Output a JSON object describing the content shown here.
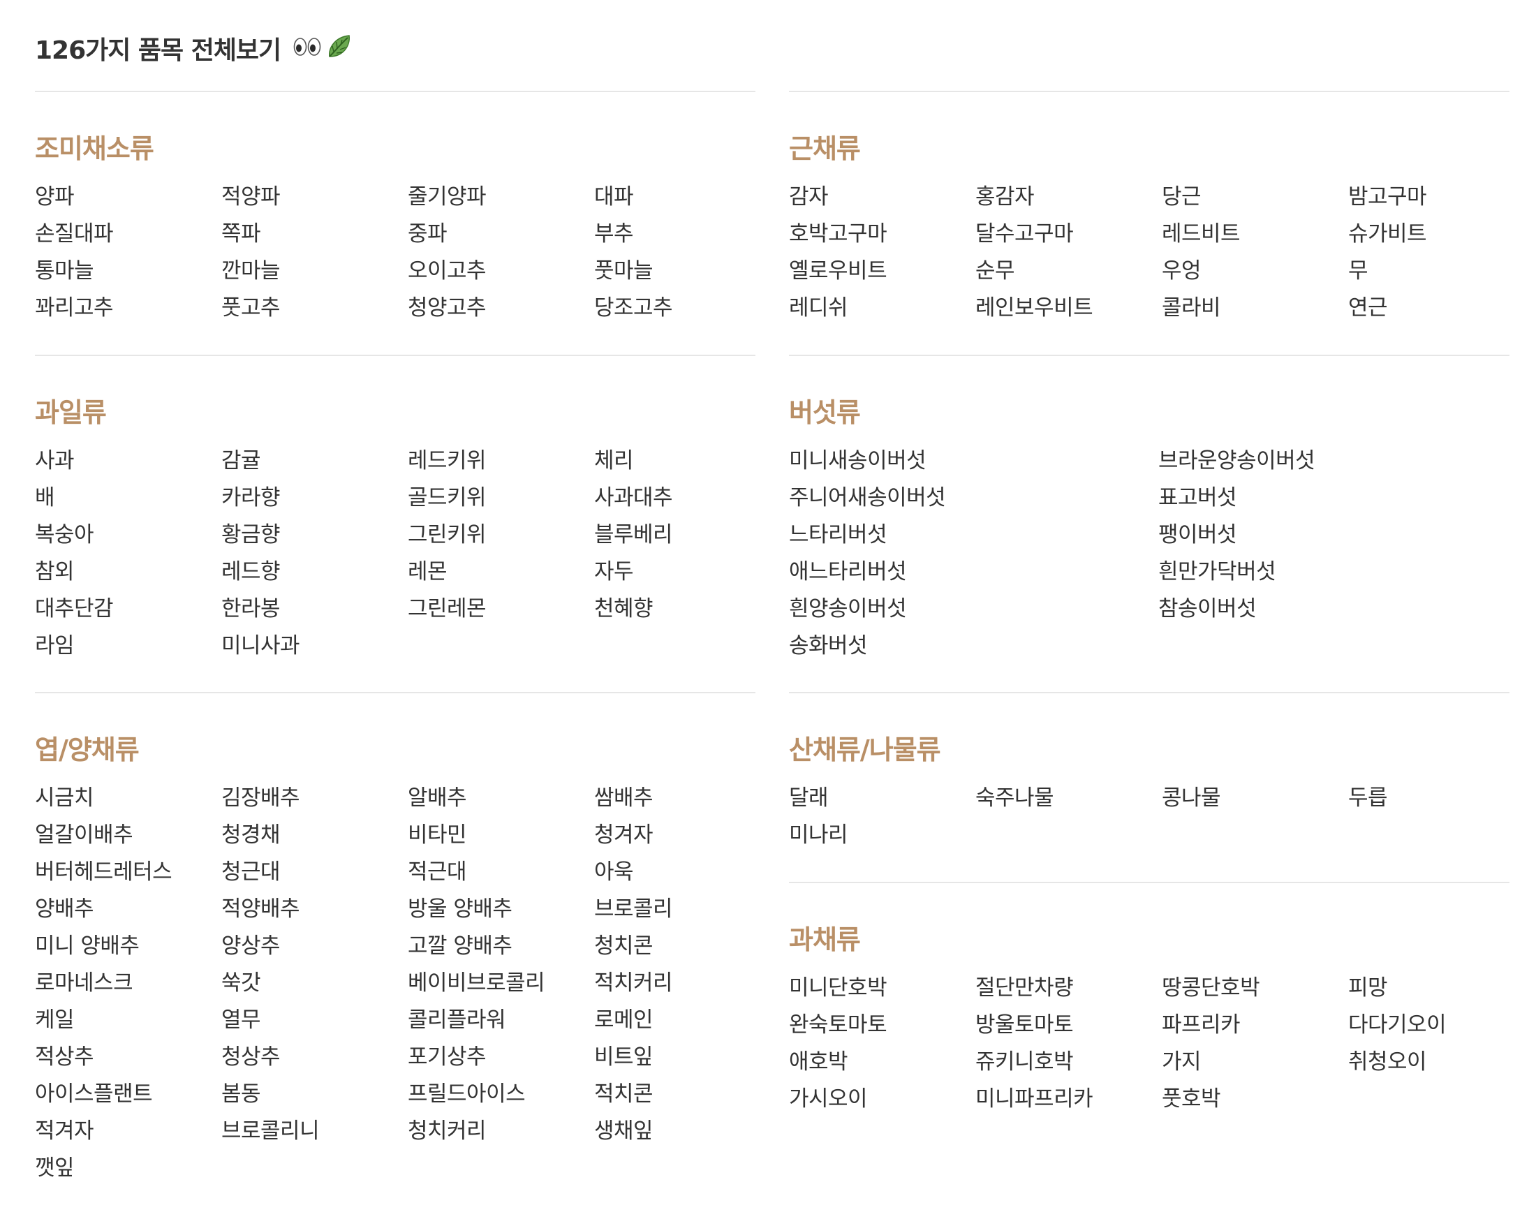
{
  "page": {
    "title": "126가지 품목 전체보기",
    "title_icons": [
      "eyes-icon",
      "leafy-green-icon"
    ]
  },
  "colors": {
    "section_title": "#b98f66",
    "divider": "#e6e6e6",
    "text": "#333333"
  },
  "sections": {
    "seasoning": {
      "title": "조미채소류",
      "items": [
        "양파",
        "적양파",
        "줄기양파",
        "대파",
        "손질대파",
        "쪽파",
        "중파",
        "부추",
        "통마늘",
        "깐마늘",
        "오이고추",
        "풋마늘",
        "꽈리고추",
        "풋고추",
        "청양고추",
        "당조고추"
      ]
    },
    "root": {
      "title": "근채류",
      "items": [
        "감자",
        "홍감자",
        "당근",
        "밤고구마",
        "호박고구마",
        "달수고구마",
        "레드비트",
        "슈가비트",
        "옐로우비트",
        "순무",
        "우엉",
        "무",
        "레디쉬",
        "레인보우비트",
        "콜라비",
        "연근"
      ]
    },
    "fruit": {
      "title": "과일류",
      "items": [
        "사과",
        "감귤",
        "레드키위",
        "체리",
        "배",
        "카라향",
        "골드키위",
        "사과대추",
        "복숭아",
        "황금향",
        "그린키위",
        "블루베리",
        "참외",
        "레드향",
        "레몬",
        "자두",
        "대추단감",
        "한라봉",
        "그린레몬",
        "천혜향",
        "라임",
        "미니사과"
      ]
    },
    "mushroom": {
      "title": "버섯류",
      "items": [
        "미니새송이버섯",
        "브라운양송이버섯",
        "주니어새송이버섯",
        "표고버섯",
        "느타리버섯",
        "팽이버섯",
        "애느타리버섯",
        "흰만가닥버섯",
        "흰양송이버섯",
        "참송이버섯",
        "송화버섯"
      ]
    },
    "leafy": {
      "title": "엽/양채류",
      "items": [
        "시금치",
        "김장배추",
        "알배추",
        "쌈배추",
        "얼갈이배추",
        "청경채",
        "비타민",
        "청겨자",
        "버터헤드레터스",
        "청근대",
        "적근대",
        "아욱",
        "양배추",
        "적양배추",
        "방울 양배추",
        "브로콜리",
        "미니 양배추",
        "양상추",
        "고깔 양배추",
        "청치콘",
        "로마네스크",
        "쑥갓",
        "베이비브로콜리",
        "적치커리",
        "케일",
        "열무",
        "콜리플라워",
        "로메인",
        "적상추",
        "청상추",
        "포기상추",
        "비트잎",
        "아이스플랜트",
        "봄동",
        "프릴드아이스",
        "적치콘",
        "적겨자",
        "브로콜리니",
        "청치커리",
        "생채잎",
        "깻잎"
      ]
    },
    "wild": {
      "title": "산채류/나물류",
      "items": [
        "달래",
        "숙주나물",
        "콩나물",
        "두릅",
        "미나리"
      ]
    },
    "fruit_veg": {
      "title": "과채류",
      "items": [
        "미니단호박",
        "절단만차량",
        "땅콩단호박",
        "피망",
        "완숙토마토",
        "방울토마토",
        "파프리카",
        "다다기오이",
        "애호박",
        "쥬키니호박",
        "가지",
        "취청오이",
        "가시오이",
        "미니파프리카",
        "풋호박"
      ]
    }
  }
}
